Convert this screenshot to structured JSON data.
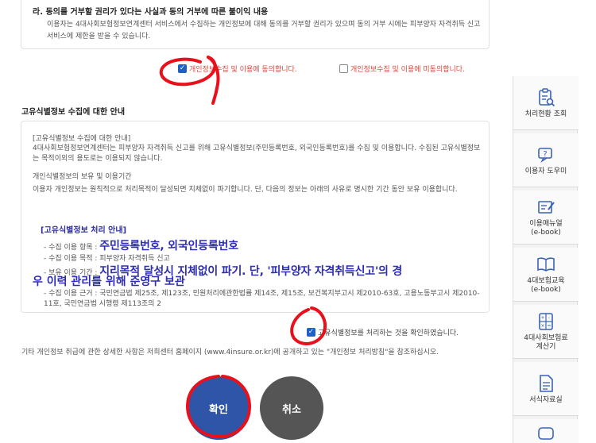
{
  "top_section": {
    "title": "라. 동의를 거부할 권리가 있다는 사실과 동의 거부에 따른 불이익 내용",
    "text": "이용자는 4대사회보험정보연계센터 서비스에서 수집하는 개인정보에 대해 동의를 거부할 권리가 있으며 동의 거부 시에는 피부양자 자격취득 신고 서비스에 제한을 받을 수 있습니다."
  },
  "agree": {
    "agree_label": "개인정보수집 및 이용에 동의합니다.",
    "agree_checked": true,
    "disagree_label": "개인정보수집 및 이용에 미동의합니다.",
    "disagree_checked": false
  },
  "unique_info": {
    "section_title": "고유식별정보 수집에 대한 안내",
    "p1": "[고유식별정보 수집에 대한 안내]",
    "p2": "4대사회보험정보연계센터는 피부양자 자격취득 신고를 위해 고유식별정보(주민등록번호, 외국인등록번호)를 수집 및 이용합니다. 수집된 고유식별정보는 목적이외의 용도로는 이용되지 않습니다.",
    "p3": "개인식별정보의 보유 및 이용기간",
    "p4": "이용자 개인정보는 원칙적으로 처리목적이 달성되면 지체없이 파기합니다. 단, 다음의 정보는 아래의 사유로 명시한 기간 동안 보유 이용합니다.",
    "ref_title": "[고유식별정보 처리 안내]",
    "item1_label": "- 수집 이용 항목 : ",
    "item1_value": "주민등록번호, 외국인등록번호",
    "item2_label": "- 수집 이용 목적 : 피부양자 자격취득 신고",
    "item3_label": "- 보유 이용 기간 : ",
    "item3_value_a": "지리목적 달성시 지체없이 파기. 단, '피부양자 자격취득신고'의 경",
    "item3_value_b": "우 이력 관리를 위해 준영구 보관",
    "item4": "- 수집 이용 근거 : 국민연금법 제25조, 제123조, 민원처리에관한법률 제14조, 제15조, 보건복지부고시 제2010-63호, 고용노동부고시 제2010-11호, 국민연금법 시행령 제113조의 2"
  },
  "confirm": {
    "label": "고유식별정보를 처리하는 것을 확인하였습니다.",
    "checked": true
  },
  "footer_text": "기타 개인정보 취급에 관한 상세한 사항은 저희센터 홈페이지 (www.4insure.or.kr)에 공개하고 있는 \"개인정보 처리방침\"을 참조하십시오.",
  "buttons": {
    "ok": "확인",
    "cancel": "취소"
  },
  "sidebar": {
    "items": [
      {
        "label": "처리현황 조회",
        "icon": "clipboard-search-icon"
      },
      {
        "label": "이용자 도우미",
        "icon": "help-question-icon"
      },
      {
        "label": "이용매뉴얼\n(e-book)",
        "icon": "manual-pencil-icon"
      },
      {
        "label": "4대보험교육\n(e-book)",
        "icon": "open-book-icon"
      },
      {
        "label": "4대사회보험료\n계산기",
        "icon": "calculator-icon"
      },
      {
        "label": "서식자료실",
        "icon": "document-icon"
      }
    ]
  },
  "colors": {
    "accent_blue": "#2e55a8",
    "checkbox_blue": "#1e5fc8",
    "agree_red": "#e0463a",
    "highlight_text": "#2c2cb8",
    "annotation_red": "#e8101a"
  }
}
